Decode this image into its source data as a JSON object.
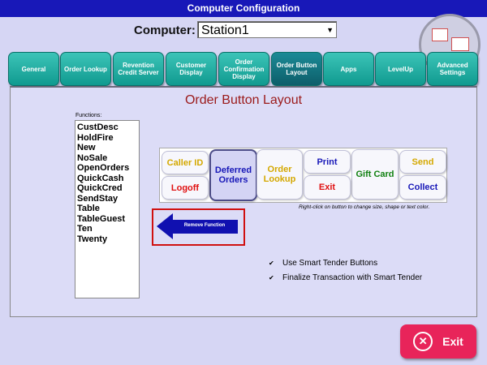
{
  "window": {
    "title": "Computer Configuration"
  },
  "computer": {
    "label": "Computer:",
    "value": "Station1"
  },
  "tabs": [
    {
      "label": "General"
    },
    {
      "label": "Order Lookup"
    },
    {
      "label": "Revention Credit Server"
    },
    {
      "label": "Customer Display"
    },
    {
      "label": "Order Confirmation Display"
    },
    {
      "label": "Order Button Layout",
      "active": true
    },
    {
      "label": "Apps"
    },
    {
      "label": "LevelUp"
    },
    {
      "label": "Advanced Settings"
    }
  ],
  "page_title": "Order Button Layout",
  "functions": {
    "label": "Functions:",
    "items": [
      "CustDesc",
      "HoldFire",
      "New",
      "NoSale",
      "OpenOrders",
      "QuickCash",
      "QuickCred",
      "SendStay",
      "Table",
      "TableGuest",
      "Ten",
      "Twenty"
    ]
  },
  "order_buttons": [
    {
      "label": "Caller ID",
      "color": "#d4a800"
    },
    {
      "label": "Deferred Orders",
      "color": "#1818b8"
    },
    {
      "label": "Order Lookup",
      "color": "#d4a800"
    },
    {
      "label": "Print",
      "color": "#1818b8"
    },
    {
      "label": "Gift Card",
      "color": "#108010"
    },
    {
      "label": "Send",
      "color": "#d4a800"
    },
    {
      "label": "Logoff",
      "color": "#e01010"
    },
    {
      "label": "Exit",
      "color": "#e01010"
    },
    {
      "label": "Collect",
      "color": "#1818b8"
    }
  ],
  "hint": "Right-click on button to change size, shape or text color.",
  "remove_function": {
    "label": "Remove Function"
  },
  "checkboxes": [
    {
      "label": "Use Smart Tender Buttons",
      "checked": true,
      "mark": "✔"
    },
    {
      "label": "Finalize Transaction with Smart Tender",
      "checked": true,
      "mark": "✔"
    }
  ],
  "exit_button": {
    "label": "Exit",
    "icon": "✕"
  }
}
